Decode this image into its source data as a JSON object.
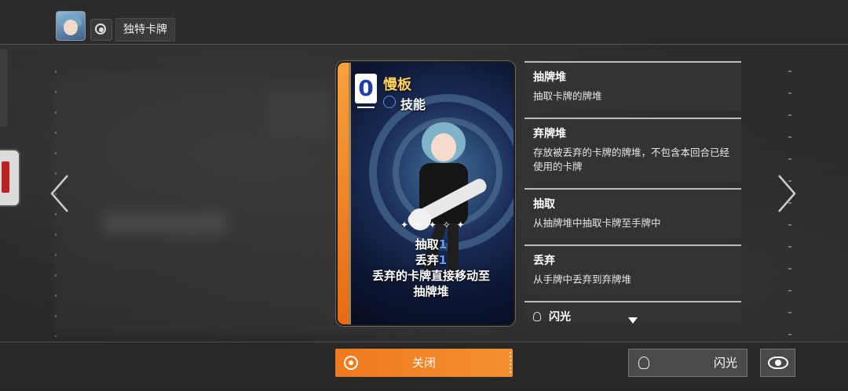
{
  "header": {
    "title": "独特卡牌"
  },
  "card": {
    "cost": "0",
    "name": "慢板",
    "type": "技能",
    "desc_line1_label": "抽取",
    "desc_line1_value": "1",
    "desc_line2_label": "丢弃",
    "desc_line2_value": "1",
    "desc_line3": "丢弃的卡牌直接移动至",
    "desc_line4": "抽牌堆"
  },
  "glossary": [
    {
      "title": "抽牌堆",
      "text": "抽取卡牌的牌堆"
    },
    {
      "title": "弃牌堆",
      "text": "存放被丢弃的卡牌的牌堆，不包含本回合已经使用的卡牌"
    },
    {
      "title": "抽取",
      "text": "从抽牌堆中抽取卡牌至手牌中"
    },
    {
      "title": "丢弃",
      "text": "从手牌中丢弃到弃牌堆"
    },
    {
      "title": "闪光",
      "text": ""
    }
  ],
  "buttons": {
    "close": "关闭",
    "flash": "闪光"
  },
  "colors": {
    "accent": "#f07a1e",
    "card_name": "#ffd35a",
    "value_blue": "#5aa0ff"
  },
  "icons": {
    "target": "target-icon",
    "bulb": "lightbulb-icon",
    "eye": "eye-icon",
    "prev": "chevron-left-icon",
    "next": "chevron-right-icon"
  }
}
